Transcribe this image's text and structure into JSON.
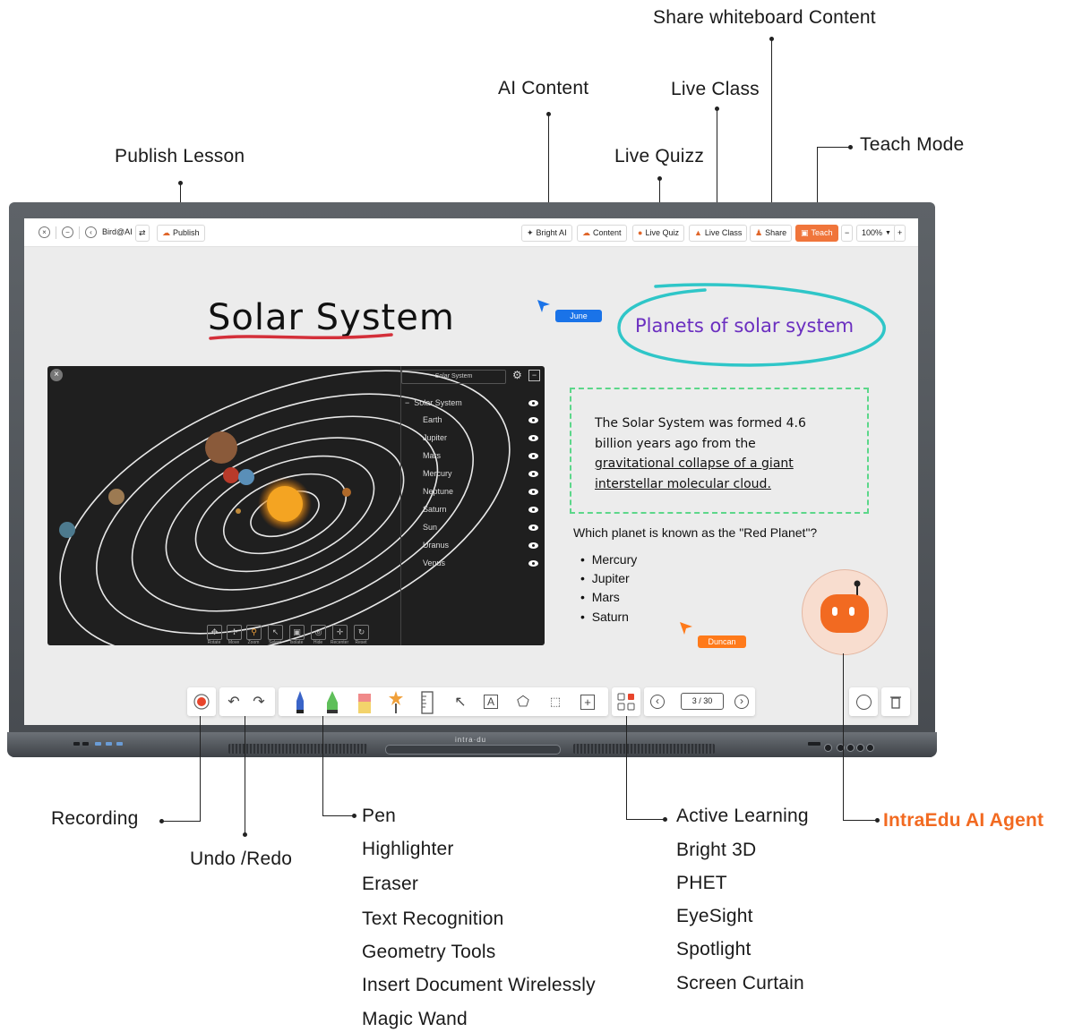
{
  "callouts": {
    "share_whiteboard": "Share whiteboard Content",
    "ai_content": "AI Content",
    "live_class": "Live Class",
    "live_quizz": "Live Quizz",
    "teach_mode": "Teach Mode",
    "publish_lesson": "Publish Lesson",
    "recording": "Recording",
    "undo_redo": "Undo /Redo",
    "pen_tools": [
      "Pen",
      "Highlighter",
      "Eraser",
      "Text Recognition",
      "Geometry Tools",
      "Insert Document Wirelessly",
      "Magic Wand"
    ],
    "active_tools": [
      "Active Learning",
      "Bright 3D",
      "PHET",
      "EyeSight",
      "Spotlight",
      "Screen Curtain"
    ],
    "ai_agent": "IntraEdu AI Agent"
  },
  "topbar": {
    "bird_ai": "Bird@AI",
    "publish": "Publish",
    "bright_ai": "Bright AI",
    "content": "Content",
    "live_quiz": "Live Quiz",
    "live_class": "Live Class",
    "share": "Share",
    "teach": "Teach",
    "zoom": "100%",
    "zoom_minus": "−",
    "zoom_plus": "+"
  },
  "canvas": {
    "title": "Solar System",
    "planets_note": "Planets of solar system",
    "cursor_june": "June",
    "cursor_duncan": "Duncan",
    "fact_lines": [
      "The Solar System was formed 4.6",
      "billion years ago from the",
      "gravitational collapse of a giant",
      "interstellar molecular cloud."
    ],
    "quiz_question": "Which planet is known as the \"Red Planet\"?",
    "quiz_options": [
      "Mercury",
      "Jupiter",
      "Mars",
      "Saturn"
    ]
  },
  "solar_widget": {
    "panel_title": "Solar System",
    "root_item": "Solar System",
    "items": [
      "Earth",
      "Jupiter",
      "Mars",
      "Mercury",
      "Neptune",
      "Saturn",
      "Sun",
      "Uranus",
      "Venus"
    ],
    "controls": [
      "Rotate",
      "Move",
      "Zoom",
      "Select",
      "Isolate",
      "Hide",
      "Recenter",
      "Reset"
    ]
  },
  "bottombar": {
    "page": "3 / 30"
  },
  "device": {
    "brand": "intra·du"
  },
  "colors": {
    "accent": "#f0753b",
    "agent_orange": "#f26a21",
    "note_purple": "#6b2fc0",
    "cyan_ring": "#2fc6c8",
    "dashed_green": "#5cd78a",
    "june_blue": "#1a73e8",
    "duncan_orange": "#ff7a1a"
  }
}
